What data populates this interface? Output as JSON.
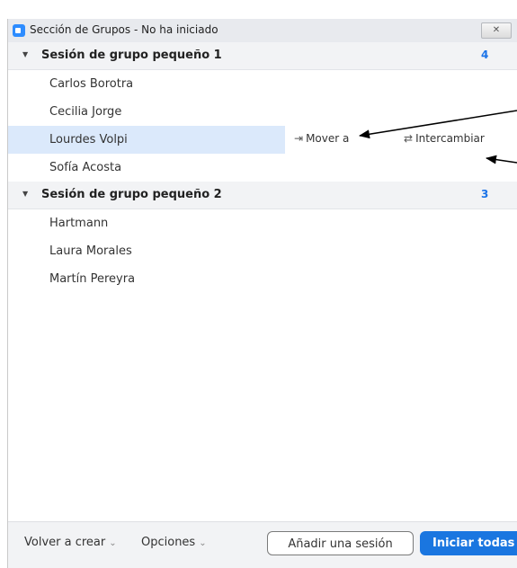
{
  "window": {
    "title": "Sección de Grupos - No ha iniciado",
    "close_label": "✕"
  },
  "groups": [
    {
      "name": "Sesión de grupo pequeño 1",
      "count": "4",
      "members": [
        "Carlos Borotra",
        "Cecilia Jorge",
        "Lourdes Volpi",
        "Sofía Acosta"
      ]
    },
    {
      "name": "Sesión de grupo pequeño 2",
      "count": "3",
      "members": [
        "Hartmann",
        "Laura Morales",
        "Martín Pereyra"
      ]
    }
  ],
  "row_actions": {
    "move_label": "Mover a",
    "move_icon": "move-to-icon",
    "swap_label": "Intercambiar",
    "swap_icon": "swap-icon"
  },
  "footer": {
    "recreate_label": "Volver a crear",
    "options_label": "Opciones",
    "add_session_label": "Añadir una sesión",
    "start_all_label": "Iniciar todas"
  },
  "colors": {
    "accent": "#1a76e0",
    "highlight": "#dbe9fb",
    "header_bg": "#f2f3f5",
    "count": "#1a73e8"
  }
}
